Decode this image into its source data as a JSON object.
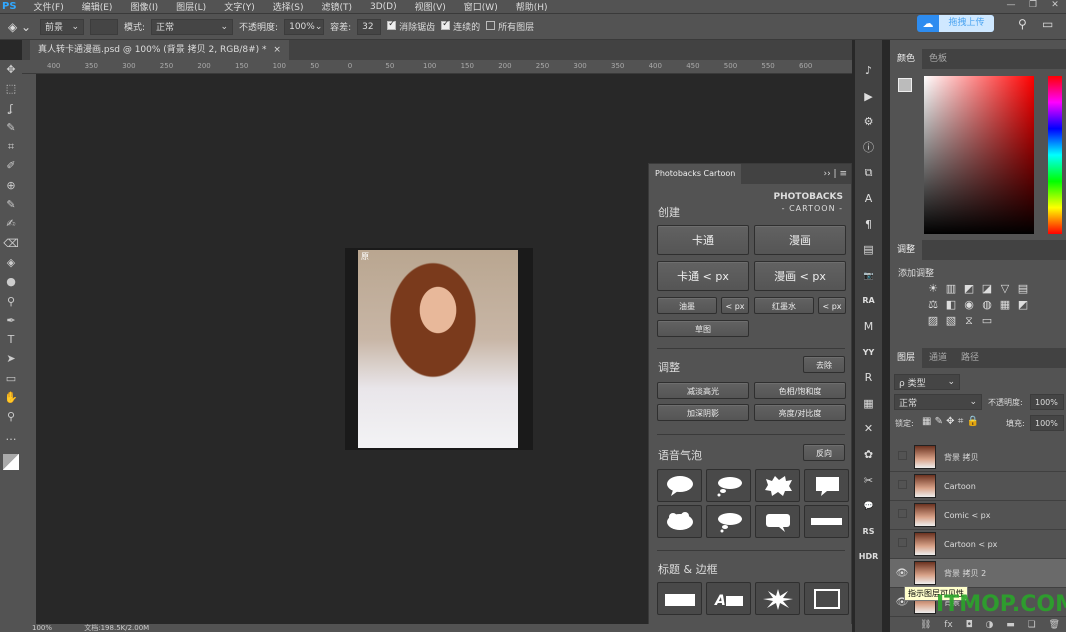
{
  "menubar": {
    "logo": "PS",
    "items": [
      "文件(F)",
      "编辑(E)",
      "图像(I)",
      "图层(L)",
      "文字(Y)",
      "选择(S)",
      "滤镜(T)",
      "3D(D)",
      "视图(V)",
      "窗口(W)",
      "帮助(H)"
    ],
    "window_controls": [
      "—",
      "❐",
      "✕"
    ]
  },
  "options": {
    "fill_source": "前景",
    "mode_label": "模式:",
    "mode": "正常",
    "opacity_label": "不透明度:",
    "opacity": "100%",
    "tolerance_label": "容差:",
    "tolerance": "32",
    "antialias": "消除锯齿",
    "antialias_checked": true,
    "contiguous": "连续的",
    "contiguous_checked": true,
    "all_layers": "所有图层",
    "all_layers_checked": false,
    "upload": "拖拽上传"
  },
  "document": {
    "tab_title": "真人转卡通漫画.psd @ 100% (背景 拷贝 2, RGB/8#) *",
    "close": "×",
    "image_label": "原"
  },
  "ruler": [
    "400",
    "350",
    "300",
    "250",
    "200",
    "150",
    "100",
    "50",
    "0",
    "50",
    "100",
    "150",
    "200",
    "250",
    "300",
    "350",
    "400",
    "450",
    "500",
    "550",
    "600"
  ],
  "photobacks": {
    "tab": "Photobacks Cartoon",
    "brand": "PHOTOBACKS",
    "brand_sub": "- CARTOON -",
    "create": "创建",
    "cartoon": "卡通",
    "comic": "漫画",
    "cartoon_px": "卡通 < px",
    "comic_px": "漫画 < px",
    "oil": "油墨",
    "oil_px": "< px",
    "marker": "红墨水",
    "marker_px": "< px",
    "sketch": "草图",
    "adjust": "调整",
    "remove": "去除",
    "reduce_highlights": "减淡高光",
    "hue_sat": "色相/饱和度",
    "deepen_shadows": "加深阴影",
    "brightness": "亮度/对比度",
    "bubbles": "语音气泡",
    "reverse": "反向",
    "titles": "标题 & 边框"
  },
  "color_panel": {
    "tabs": [
      "颜色",
      "色板"
    ]
  },
  "adjustments": {
    "tab": "调整",
    "add": "添加调整",
    "icons": [
      "☀",
      "▥",
      "◩",
      "◪",
      "▽",
      "▤",
      "⚖",
      "◧",
      "◉",
      "◍",
      "▦",
      "◩",
      "▨",
      "▧",
      "⧖",
      "▭"
    ]
  },
  "layers": {
    "tabs": [
      "图层",
      "通道",
      "路径"
    ],
    "filter": "ρ 类型",
    "blend": "正常",
    "opacity_label": "不透明度:",
    "opacity": "100%",
    "lock_label": "锁定:",
    "fill_label": "填充:",
    "fill": "100%",
    "items": [
      {
        "name": "背景 拷贝",
        "visible": false
      },
      {
        "name": "Cartoon",
        "visible": false
      },
      {
        "name": "Comic < px",
        "visible": false
      },
      {
        "name": "Cartoon < px",
        "visible": false
      },
      {
        "name": "背景 拷贝 2",
        "visible": true,
        "selected": true
      },
      {
        "name": "背景",
        "visible": true
      }
    ],
    "tooltip": "指示图层可见性",
    "footer": [
      "⛓",
      "fx",
      "◘",
      "◑",
      "▬",
      "❏",
      "🗑"
    ]
  },
  "watermark": "ITMOP.COM",
  "status": {
    "zoom": "100%",
    "doc": "文档:198.5K/2.00M"
  },
  "toolbar_icons": [
    "✥",
    "⬚",
    "ʆ",
    "✎",
    "⌗",
    "✐",
    "⊕",
    "✎",
    "✍",
    "⌫",
    "◈",
    "●",
    "⚲",
    "✒",
    "T",
    "➤",
    "▭",
    "✋",
    "⚲",
    "…"
  ],
  "strip_icons": [
    "♪",
    "▶",
    "⚙",
    "ⓘ",
    "⧉",
    "A",
    "¶",
    "▤",
    "📷",
    "RA",
    "M",
    "YY",
    "R",
    "▦",
    "✕",
    "✿",
    "✂",
    "💬",
    "RS",
    "HDR"
  ],
  "accent": "#2d8cf0"
}
